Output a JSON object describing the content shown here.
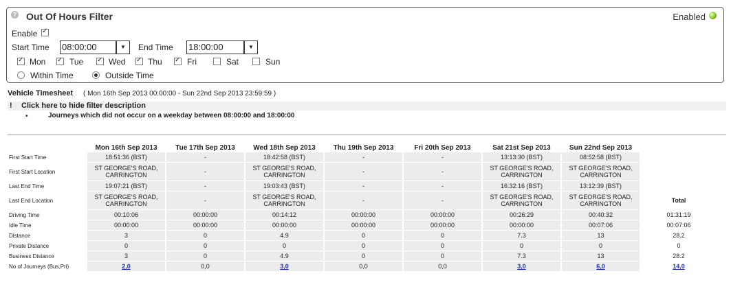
{
  "filter": {
    "title": "Out Of Hours Filter",
    "help_icon": "?",
    "status": "Enabled",
    "status_color": "#7cc21a",
    "enable_label": "Enable",
    "enable_checked": true,
    "start_label": "Start Time",
    "start_value": "08:00:00",
    "end_label": "End Time",
    "end_value": "18:00:00",
    "days": [
      {
        "label": "Mon",
        "checked": true
      },
      {
        "label": "Tue",
        "checked": true
      },
      {
        "label": "Wed",
        "checked": true
      },
      {
        "label": "Thu",
        "checked": true
      },
      {
        "label": "Fri",
        "checked": true
      },
      {
        "label": "Sat",
        "checked": false
      },
      {
        "label": "Sun",
        "checked": false
      }
    ],
    "within_label": "Within Time",
    "outside_label": "Outside Time",
    "selected_mode": "outside"
  },
  "timesheet": {
    "title": "Vehicle Timesheet",
    "range": "( Mon 16th Sep 2013 00:00:00 - Sun 22nd Sep 2013 23:59:59 )",
    "desc_mark": "!",
    "desc_toggle": "Click here to hide filter description",
    "desc_bullet": "•",
    "desc_item": "Journeys which did not occur on a weekday between 08:00:00 and 18:00:00",
    "columns": [
      "Mon 16th Sep 2013",
      "Tue 17th Sep 2013",
      "Wed 18th Sep 2013",
      "Thu 19th Sep 2013",
      "Fri 20th Sep 2013",
      "Sat 21st Sep 2013",
      "Sun 22nd Sep 2013"
    ],
    "total_header": "Total",
    "rows": [
      {
        "label": "First Start Time",
        "cells": [
          "18:51:36 (BST)",
          "-",
          "18:42:58 (BST)",
          "-",
          "-",
          "13:13:30 (BST)",
          "08:52:58 (BST)"
        ],
        "total": ""
      },
      {
        "label": "First Start Location",
        "cells": [
          "ST GEORGE'S ROAD,\nCARRINGTON",
          "-",
          "ST GEORGE'S ROAD,\nCARRINGTON",
          "-",
          "-",
          "ST GEORGE'S ROAD,\nCARRINGTON",
          "ST GEORGE'S ROAD,\nCARRINGTON"
        ],
        "total": ""
      },
      {
        "label": "Last End Time",
        "cells": [
          "19:07:21 (BST)",
          "-",
          "19:03:43 (BST)",
          "-",
          "-",
          "16:32:16 (BST)",
          "13:12:39 (BST)"
        ],
        "total": ""
      },
      {
        "label": "Last End Location",
        "cells": [
          "ST GEORGE'S ROAD,\nCARRINGTON",
          "-",
          "ST GEORGE'S ROAD,\nCARRINGTON",
          "-",
          "-",
          "ST GEORGE'S ROAD,\nCARRINGTON",
          "ST GEORGE'S ROAD,\nCARRINGTON"
        ],
        "total": "Total"
      },
      {
        "label": "Driving Time",
        "cells": [
          "00:10:06",
          "00:00:00",
          "00:14:12",
          "00:00:00",
          "00:00:00",
          "00:26:29",
          "00:40:32"
        ],
        "total": "01:31:19"
      },
      {
        "label": "Idle Time",
        "cells": [
          "00:00:00",
          "00:00:00",
          "00:00:00",
          "00:00:00",
          "00:00:00",
          "00:00:00",
          "00:07:06"
        ],
        "total": "00:07:06"
      },
      {
        "label": "Distance",
        "cells": [
          "3",
          "0",
          "4.9",
          "0",
          "0",
          "7.3",
          "13"
        ],
        "total": "28.2"
      },
      {
        "label": "Private Distance",
        "cells": [
          "0",
          "0",
          "0",
          "0",
          "0",
          "0",
          "0"
        ],
        "total": "0"
      },
      {
        "label": "Business Distance",
        "cells": [
          "3",
          "0",
          "4.9",
          "0",
          "0",
          "7.3",
          "13"
        ],
        "total": "28.2"
      },
      {
        "label": "No of Journeys (Bus,Pri)",
        "cells": [
          "2,0",
          "0,0",
          "3,0",
          "0,0",
          "0,0",
          "3,0",
          "6,0"
        ],
        "links": [
          true,
          false,
          true,
          false,
          false,
          true,
          true
        ],
        "total": "14,0"
      }
    ]
  }
}
